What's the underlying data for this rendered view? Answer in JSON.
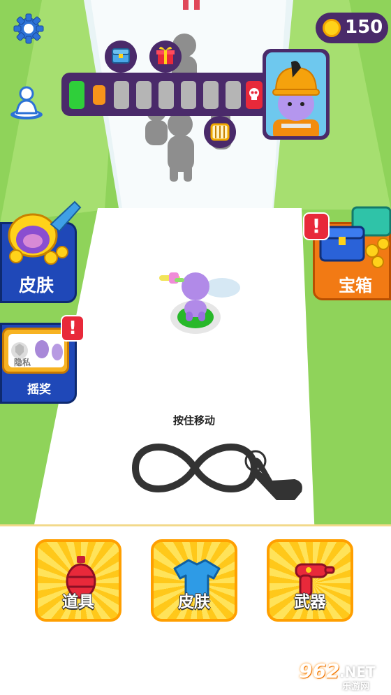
{
  "coins": {
    "value": "150",
    "icon": "coin-icon"
  },
  "progress": {
    "total_stages": 8,
    "completed": 1,
    "current": 2,
    "marker_icons": [
      "treasure-chest-icon",
      "gift-icon",
      "cage-icon",
      "skull-icon"
    ]
  },
  "boss_portrait": {
    "icon": "miner-character-icon"
  },
  "left_panel": {
    "skin_label": "皮肤",
    "lottery_label": "摇奖",
    "privacy_label": "隐私",
    "alert": "!"
  },
  "right_panel": {
    "chest_label": "宝箱",
    "alert": "!"
  },
  "hint": {
    "text": "按住移动"
  },
  "bottom_tiles": [
    {
      "label": "道具",
      "icon": "grenade-icon"
    },
    {
      "label": "皮肤",
      "icon": "tshirt-icon"
    },
    {
      "label": "武器",
      "icon": "water-gun-icon"
    }
  ],
  "watermark": {
    "brand": "962",
    "brand_suffix": ".NET",
    "subtitle": "乐游网"
  },
  "colors": {
    "accent_purple": "#4a2a6a",
    "green_field": "#8fd35a",
    "track": "#ffffff"
  }
}
